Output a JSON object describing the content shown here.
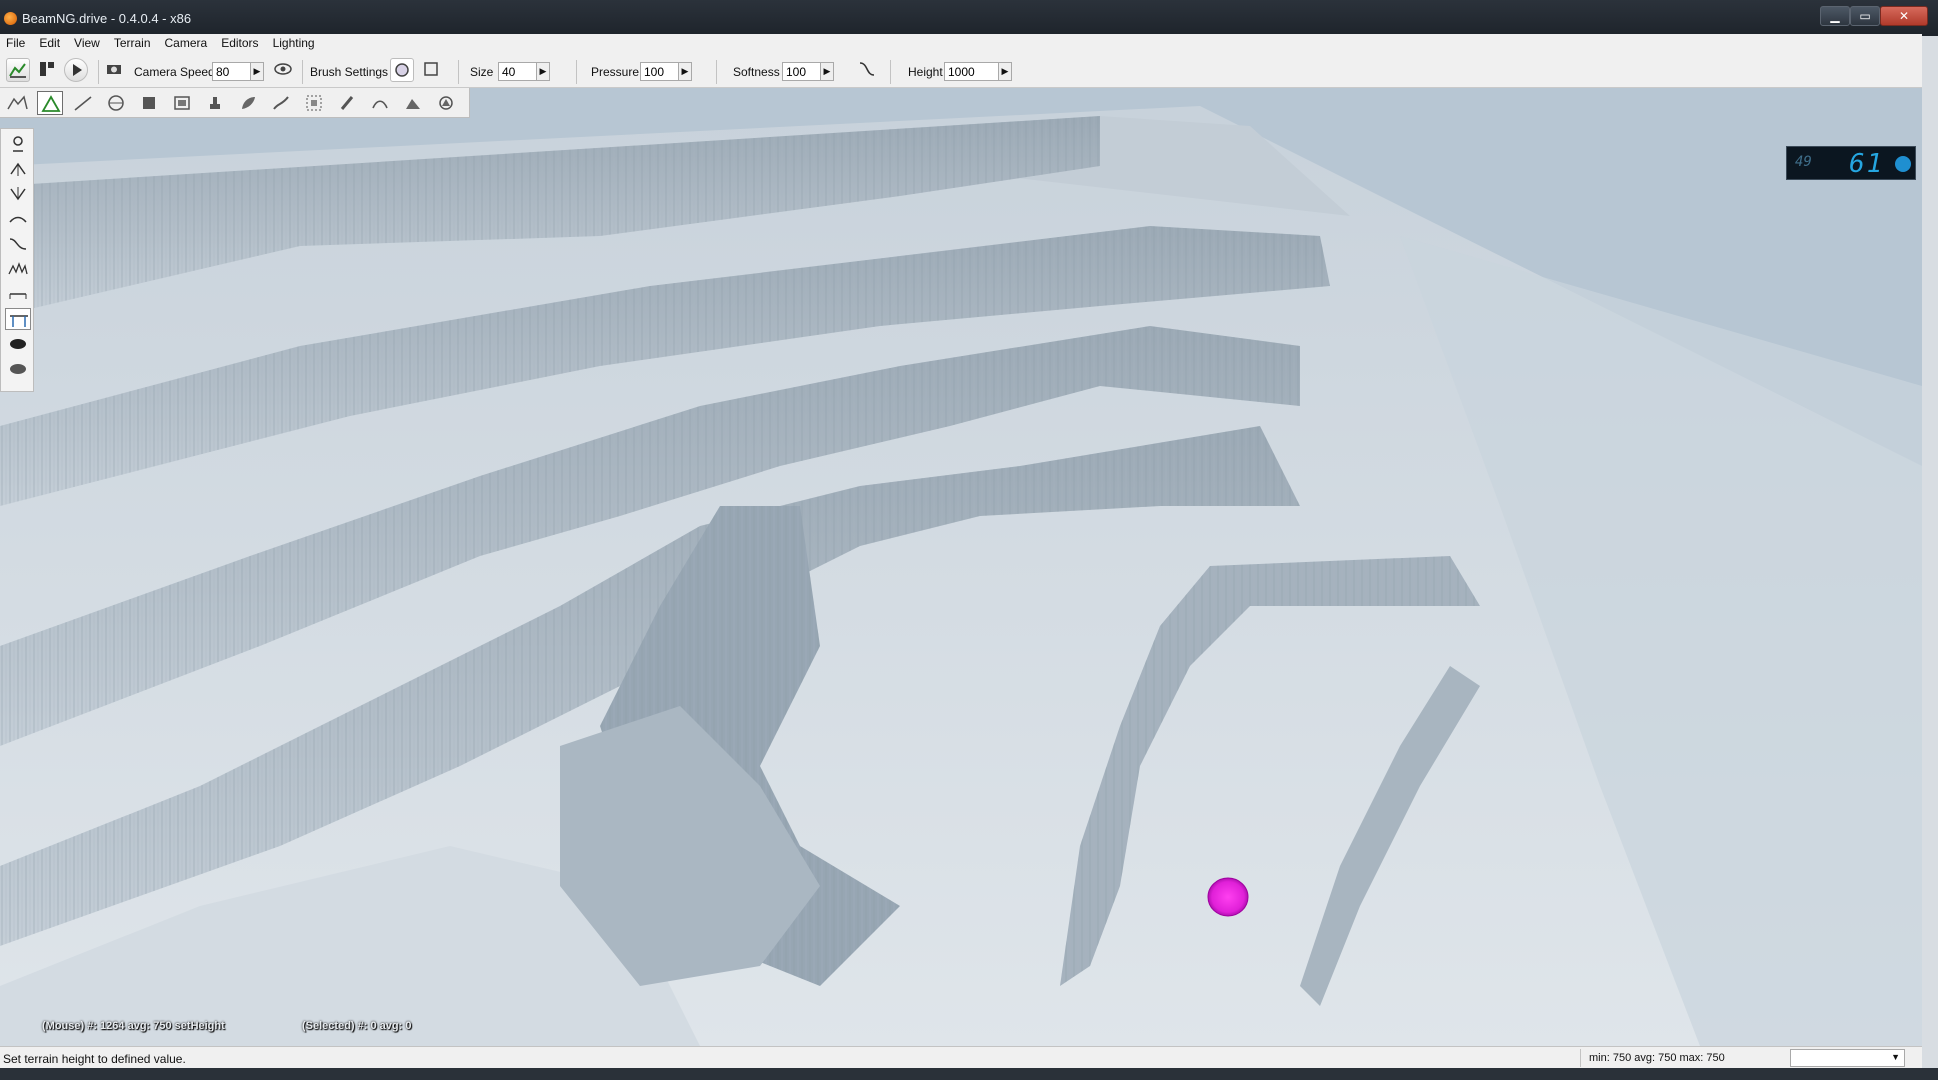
{
  "window": {
    "title": "BeamNG.drive - 0.4.0.4 - x86",
    "minimize": "▁",
    "maximize": "▭",
    "close": "✕"
  },
  "menu": {
    "items": [
      "File",
      "Edit",
      "View",
      "Terrain",
      "Camera",
      "Editors",
      "Lighting"
    ]
  },
  "toolbar": {
    "camera_speed_label": "Camera Speed",
    "camera_speed_value": "80",
    "brush_settings_label": "Brush Settings",
    "size_label": "Size",
    "size_value": "40",
    "pressure_label": "Pressure",
    "pressure_value": "100",
    "softness_label": "Softness",
    "softness_value": "100",
    "height_label": "Height",
    "height_value": "1000",
    "arrow": "▶"
  },
  "fps": {
    "small": "49",
    "big": "61"
  },
  "viewport": {
    "mouse_info": "(Mouse) #: 1264  avg: 750 setHeight",
    "selected_info": "(Selected) #: 0  avg: 0"
  },
  "statusbar": {
    "message": "Set terrain height to defined value.",
    "stats": "min: 750  avg: 750  max: 750",
    "dropdown_chevron": "▼"
  },
  "colors": {
    "brush_marker": "#e020d8",
    "terrain_sky": "#aebfcf",
    "fps_digits": "#25a6e0"
  }
}
